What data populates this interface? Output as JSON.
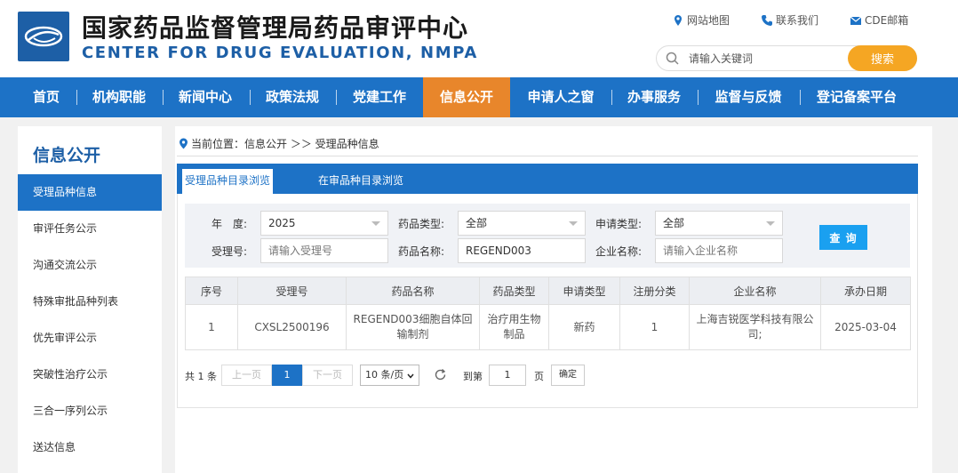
{
  "header": {
    "title_cn": "国家药品监督管理局药品审评中心",
    "title_en": "CENTER FOR DRUG EVALUATION, NMPA",
    "links": [
      {
        "label": "网站地图",
        "icon": "location-pin-icon"
      },
      {
        "label": "联系我们",
        "icon": "phone-icon"
      },
      {
        "label": "CDE邮箱",
        "icon": "mail-icon"
      }
    ],
    "search": {
      "placeholder": "请输入关键词",
      "button_label": "搜索"
    }
  },
  "nav": {
    "items": [
      "首页",
      "机构职能",
      "新闻中心",
      "政策法规",
      "党建工作",
      "信息公开",
      "申请人之窗",
      "办事服务",
      "监督与反馈",
      "登记备案平台"
    ],
    "active": "信息公开"
  },
  "sidebar": {
    "title": "信息公开",
    "items": [
      "受理品种信息",
      "审评任务公示",
      "沟通交流公示",
      "特殊审批品种列表",
      "优先审评公示",
      "突破性治疗公示",
      "三合一序列公示",
      "送达信息"
    ],
    "active": "受理品种信息"
  },
  "breadcrumb": {
    "prefix": "当前位置：",
    "path": "信息公开 ＞＞ 受理品种信息"
  },
  "tabs": [
    "受理品种目录浏览",
    "在审品种目录浏览"
  ],
  "filters": {
    "year_label": "年　度:",
    "year_value": "2025",
    "drug_type_label": "药品类型:",
    "drug_type_value": "全部",
    "apply_type_label": "申请类型:",
    "apply_type_value": "全部",
    "accept_no_label": "受理号:",
    "accept_no_placeholder": "请输入受理号",
    "drug_name_label": "药品名称:",
    "drug_name_value": "REGEND003",
    "company_label": "企业名称:",
    "company_placeholder": "请输入企业名称",
    "query_label": "查 询"
  },
  "table": {
    "headers": [
      "序号",
      "受理号",
      "药品名称",
      "药品类型",
      "申请类型",
      "注册分类",
      "企业名称",
      "承办日期"
    ],
    "rows": [
      [
        "1",
        "CXSL2500196",
        "REGEND003细胞自体回输制剂",
        "治疗用生物制品",
        "新药",
        "1",
        "上海吉锐医学科技有限公司;",
        "2025-03-04"
      ]
    ]
  },
  "pager": {
    "total": "共 1 条",
    "prev": "上一页",
    "current": "1",
    "next": "下一页",
    "page_size": "10 条/页",
    "goto_label": "到第",
    "goto_value": "1",
    "page_unit": "页",
    "confirm": "确定"
  },
  "colors": {
    "brand_blue": "#1d72c6",
    "nav_active": "#e8862b",
    "search_button": "#f5a623",
    "query_button": "#1aa0f0"
  }
}
